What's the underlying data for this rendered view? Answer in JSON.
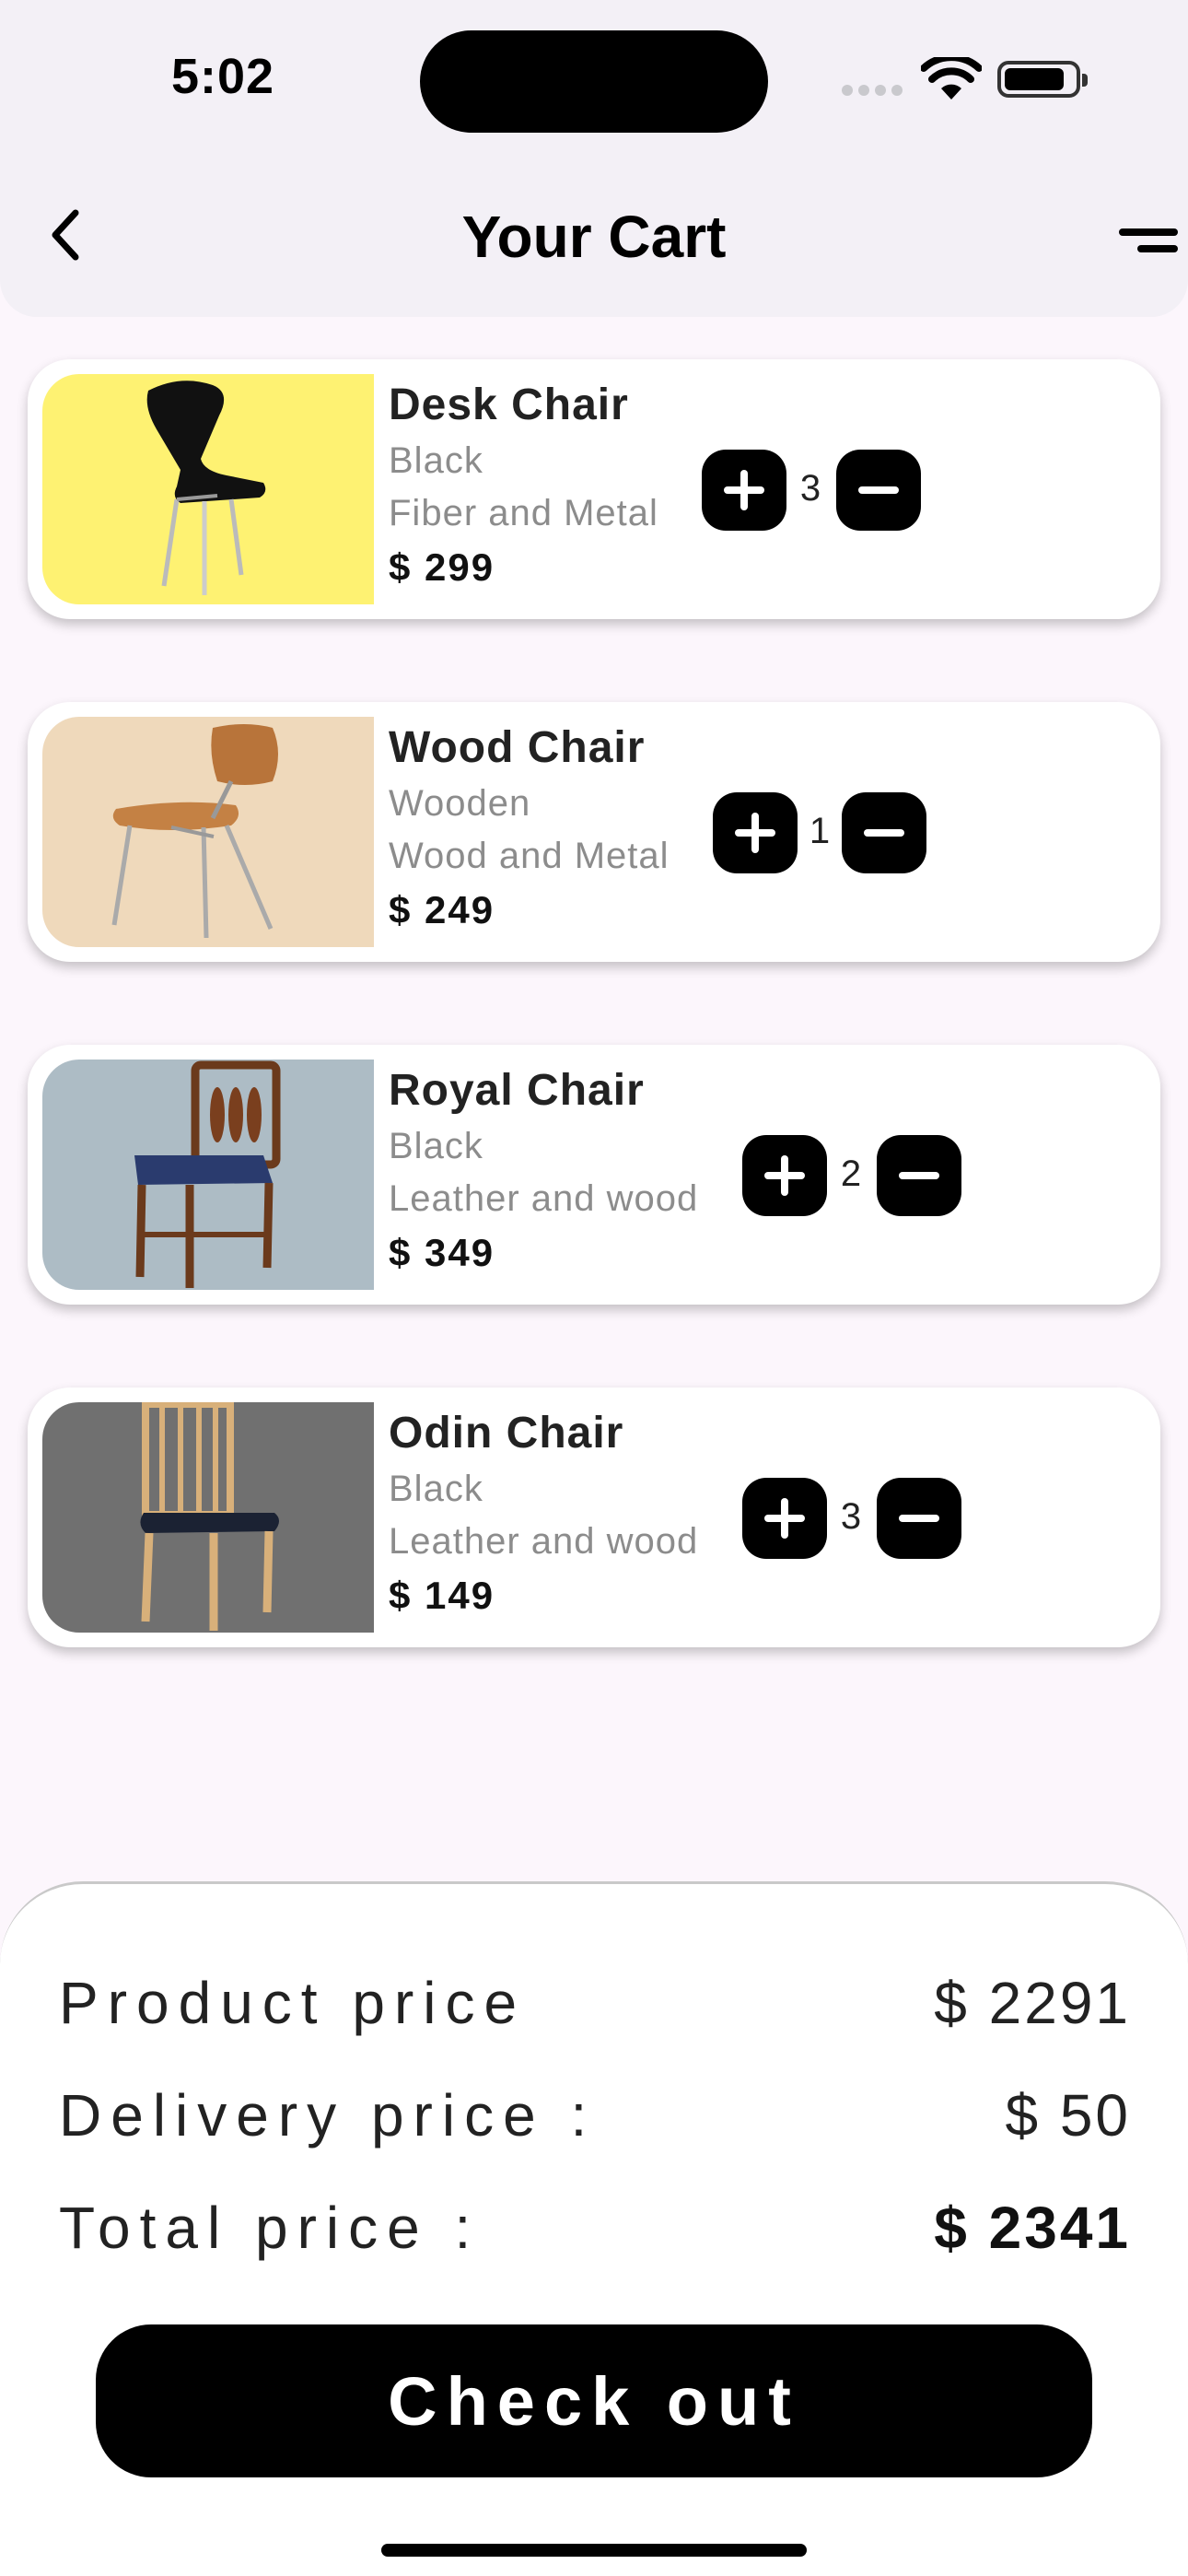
{
  "status_bar": {
    "time": "5:02"
  },
  "header": {
    "title": "Your Cart"
  },
  "cart": {
    "items": [
      {
        "name": "Desk Chair",
        "color": "Black",
        "material": "Fiber and Metal",
        "price": "$ 299",
        "quantity": "3",
        "image_bg": "#fef272"
      },
      {
        "name": "Wood Chair",
        "color": "Wooden",
        "material": "Wood and Metal",
        "price": "$ 249",
        "quantity": "1",
        "image_bg": "#efd9bb"
      },
      {
        "name": "Royal Chair",
        "color": "Black",
        "material": "Leather and wood",
        "price": "$ 349",
        "quantity": "2",
        "image_bg": "#adbcc5"
      },
      {
        "name": "Odin Chair",
        "color": "Black",
        "material": "Leather and wood",
        "price": "$ 149",
        "quantity": "3",
        "image_bg": "#707070"
      }
    ]
  },
  "summary": {
    "product_label": "Product price",
    "product_value": "$ 2291",
    "delivery_label": "Delivery price :",
    "delivery_value": "$ 50",
    "total_label": "Total price :",
    "total_value": "$ 2341",
    "checkout_label": "Check out"
  }
}
